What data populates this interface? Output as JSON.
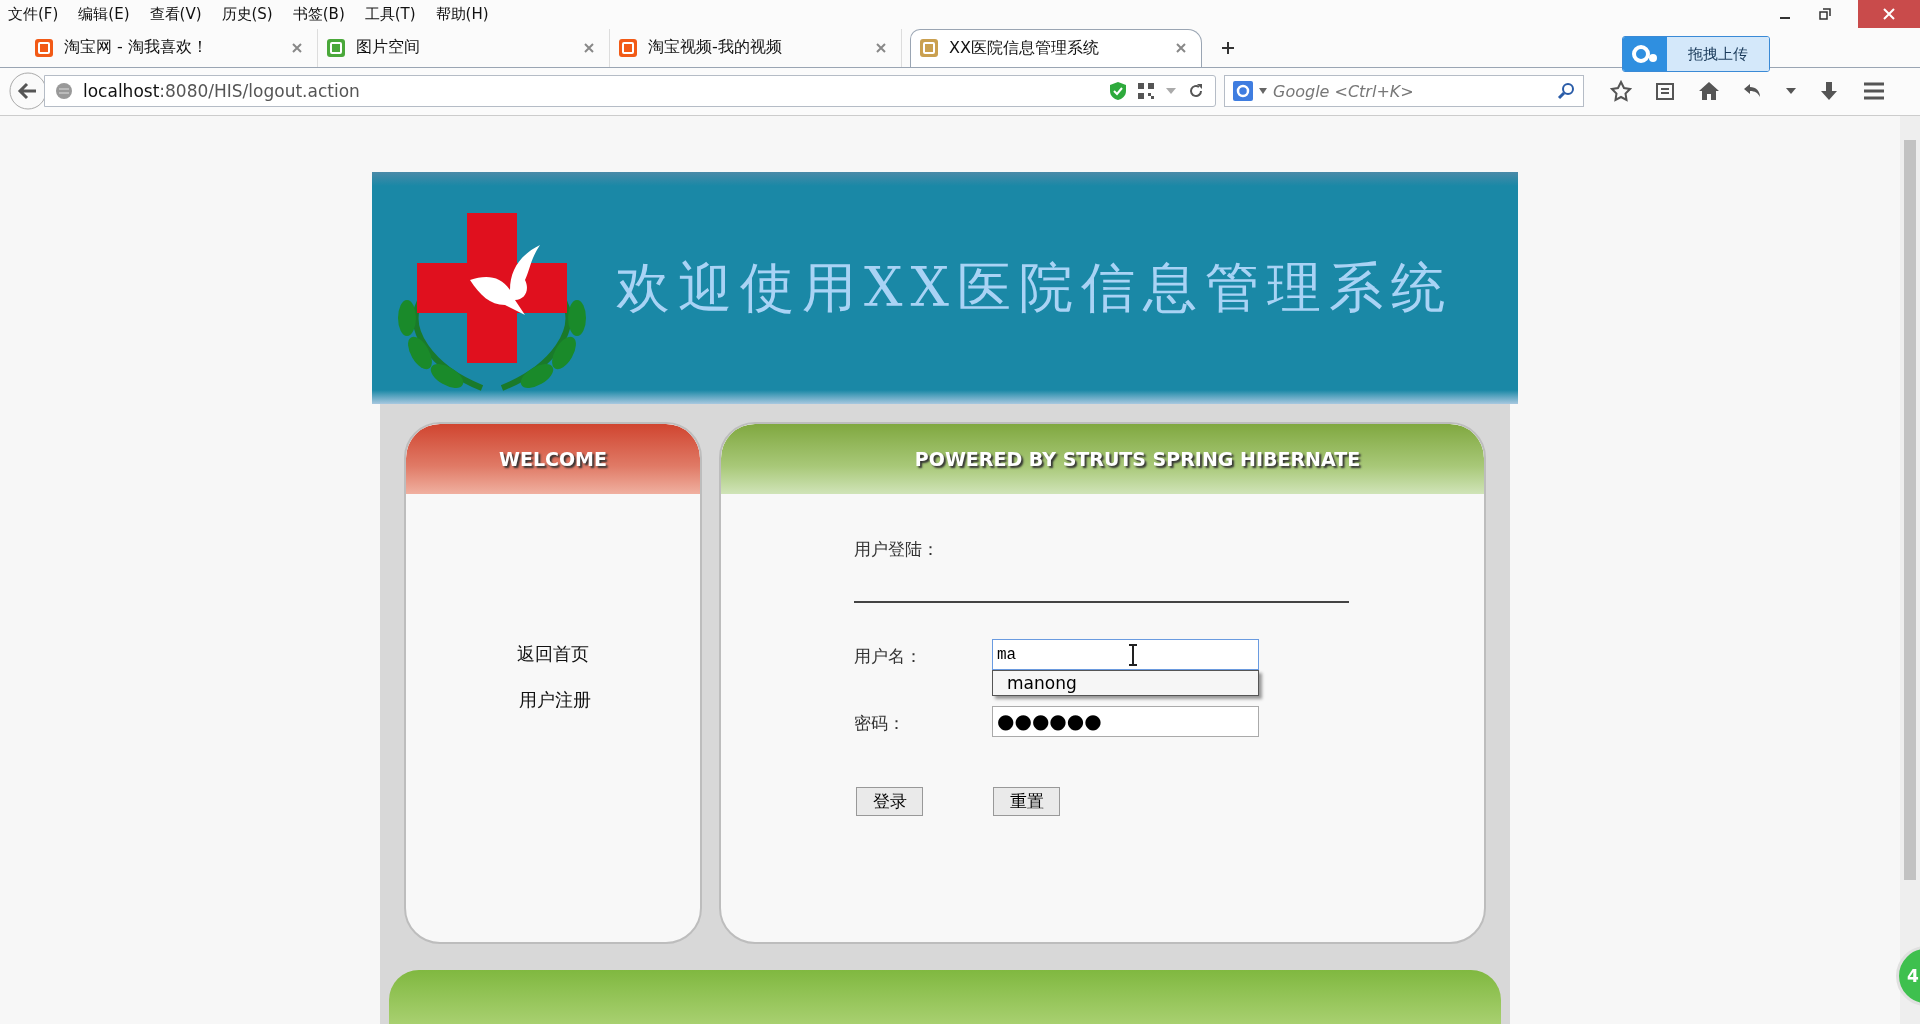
{
  "menu": [
    "文件(F)",
    "编辑(E)",
    "查看(V)",
    "历史(S)",
    "书签(B)",
    "工具(T)",
    "帮助(H)"
  ],
  "tabs": [
    {
      "title": "淘宝网 - 淘我喜欢！",
      "selected": false,
      "kind": "taobao"
    },
    {
      "title": "图片空间",
      "selected": false,
      "kind": "image"
    },
    {
      "title": "淘宝视频-我的视频",
      "selected": false,
      "kind": "taobao"
    },
    {
      "title": "XX医院信息管理系统",
      "selected": true,
      "kind": "app"
    }
  ],
  "upload_button": "拖拽上传",
  "url": {
    "host": "localhost",
    "path": ":8080/HIS/logout.action"
  },
  "search": {
    "placeholder": "Google <Ctrl+K>"
  },
  "banner": {
    "title": "欢迎使用XX医院信息管理系统"
  },
  "left_panel": {
    "header": "WELCOME",
    "links": [
      "返回首页",
      "用户注册"
    ]
  },
  "right_panel": {
    "header": "POWERED BY STRUTS SPRING HIBERNATE",
    "form": {
      "title": "用户登陆：",
      "fields": [
        {
          "label": "用户名：",
          "kind": "text",
          "value": "ma",
          "suggestions": [
            "manong"
          ]
        },
        {
          "label": "密码：",
          "kind": "password",
          "value": "●●●●●●"
        }
      ],
      "buttons": [
        "登录",
        "重置"
      ]
    }
  },
  "badge": "4"
}
